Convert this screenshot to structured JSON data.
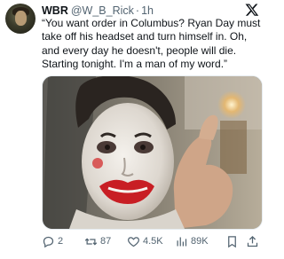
{
  "author": {
    "name": "WBR",
    "handle": "@W_B_Rick",
    "separator": "·",
    "time": "1h"
  },
  "tweet": {
    "text": "“You want order in Columbus? Ryan Day must take off his headset and turn himself in. Oh, and every day he doesn't, people will die. Starting tonight. I'm a man of my word.”"
  },
  "media": {
    "description_icon": "photo-man-with-smeared-clown-makeup"
  },
  "actions": {
    "replies": "2",
    "reposts": "87",
    "likes": "4.5K",
    "views": "89K"
  },
  "icons": {
    "brand": "x-logo-icon",
    "reply": "reply-icon",
    "repost": "repost-icon",
    "like": "heart-icon",
    "views": "views-icon",
    "bookmark": "bookmark-icon",
    "share": "share-icon"
  },
  "colors": {
    "text": "#0f1419",
    "muted": "#536471",
    "background": "#ffffff"
  }
}
